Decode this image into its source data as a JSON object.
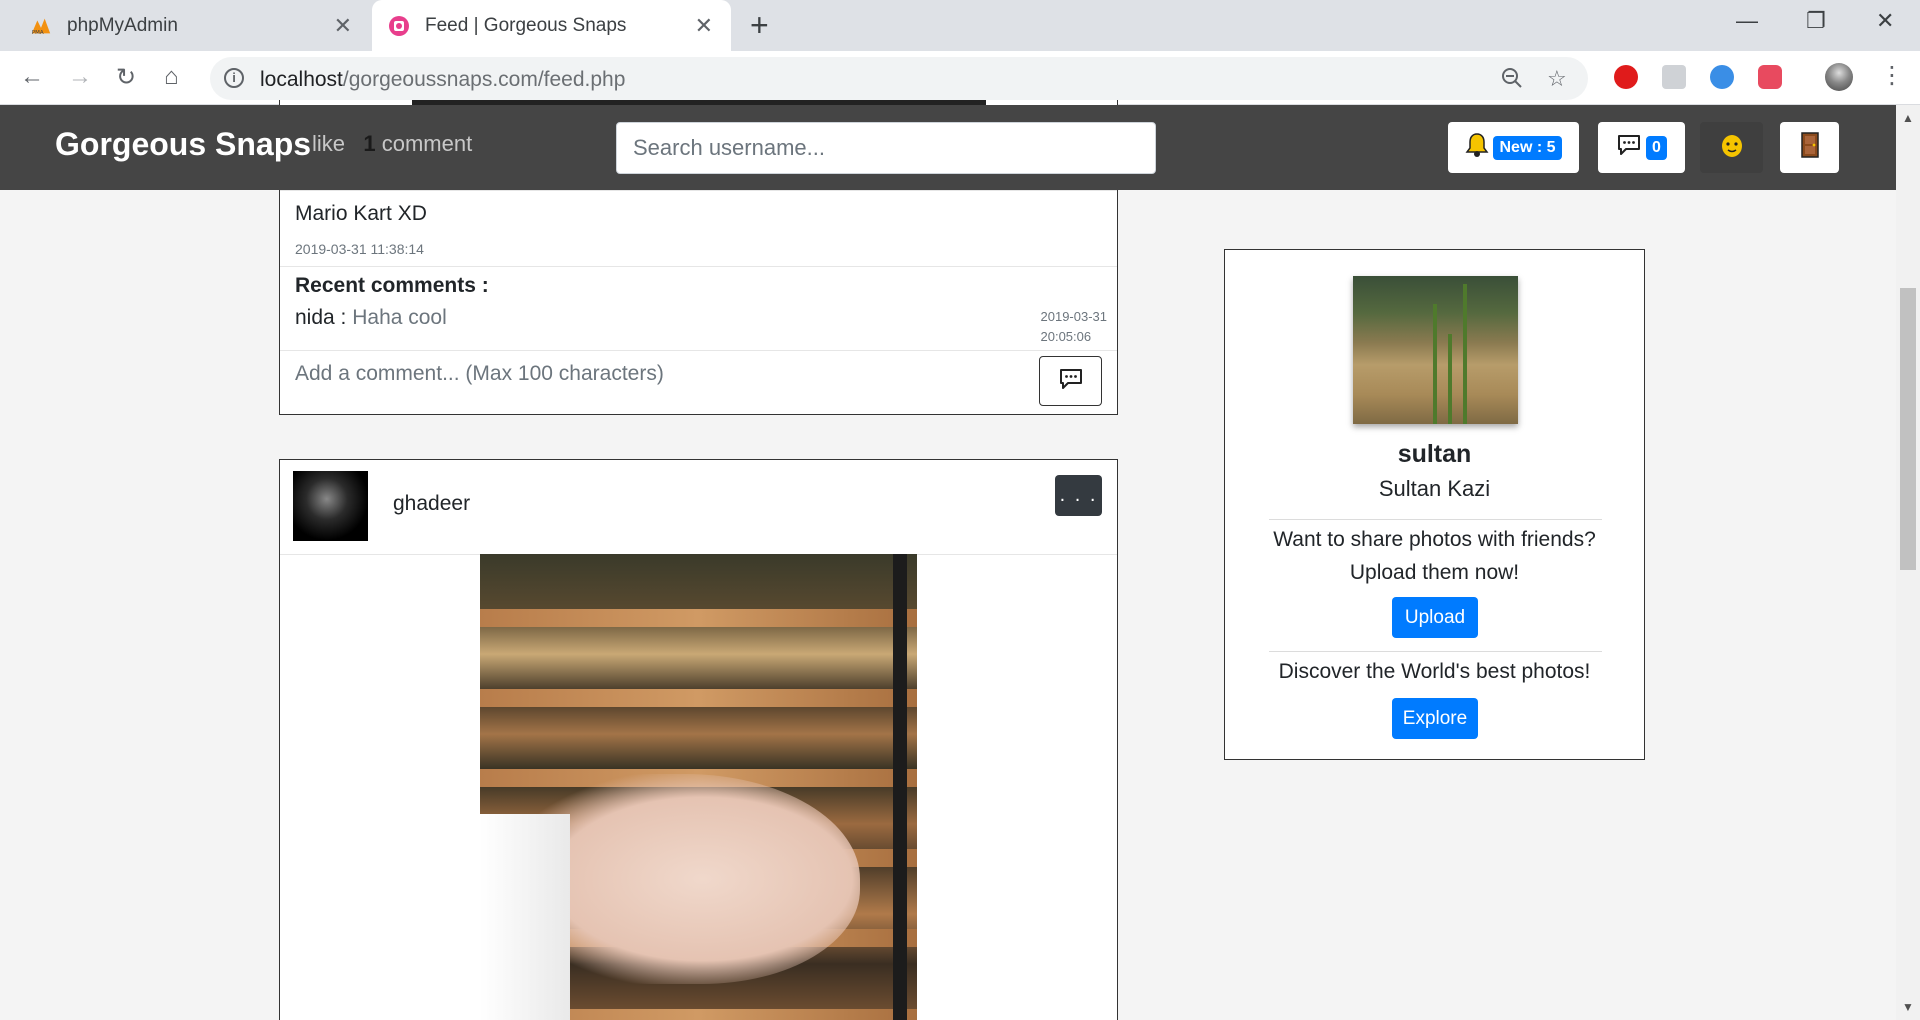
{
  "browser": {
    "tabs": [
      {
        "title": "phpMyAdmin",
        "icon": "pma-icon"
      },
      {
        "title": "Feed | Gorgeous Snaps",
        "icon": "site-icon"
      }
    ],
    "url_host": "localhost",
    "url_path": "/gorgeoussnaps.com/feed.php"
  },
  "navbar": {
    "brand": "Gorgeous Snaps",
    "search_placeholder": "Search username...",
    "notifications_badge": "New : 5",
    "messages_badge": "0"
  },
  "post1": {
    "likes_text": "like",
    "comments_count": "1",
    "comments_label": "comment",
    "caption": "Mario Kart XD",
    "timestamp": "2019-03-31 11:38:14",
    "recent_comments_title": "Recent comments :",
    "comments": [
      {
        "user": "nida",
        "separator": " : ",
        "text": "Haha cool",
        "date": "2019-03-31",
        "time": "20:05:06"
      }
    ],
    "comment_placeholder": "Add a comment... (Max 100 characters)"
  },
  "post2": {
    "username": "ghadeer",
    "more_label": ". . ."
  },
  "profile": {
    "username": "sultan",
    "full_name": "Sultan Kazi",
    "share_line1": "Want to share photos with friends?",
    "share_line2": "Upload them now!",
    "upload_label": "Upload",
    "discover_text": "Discover the World's best photos!",
    "explore_label": "Explore"
  },
  "colors": {
    "navbar": "#454545",
    "primary": "#007bff",
    "dark_button": "#343a40"
  }
}
